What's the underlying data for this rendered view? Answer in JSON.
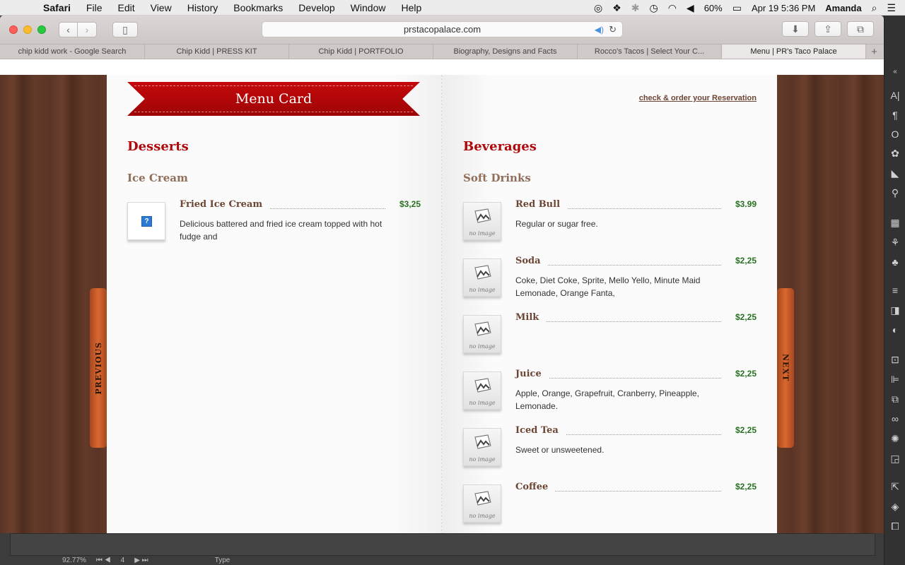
{
  "menubar": {
    "app": "Safari",
    "items": [
      "File",
      "Edit",
      "View",
      "History",
      "Bookmarks",
      "Develop",
      "Window",
      "Help"
    ],
    "battery": "60%",
    "datetime": "Apr 19  5:36 PM",
    "user": "Amanda"
  },
  "browser": {
    "url": "prstacopalace.com",
    "tabs": [
      {
        "label": "chip kidd work - Google Search",
        "active": false
      },
      {
        "label": "Chip Kidd | PRESS KIT",
        "active": false
      },
      {
        "label": "Chip Kidd | PORTFOLIO",
        "active": false
      },
      {
        "label": "Biography, Designs and Facts",
        "active": false
      },
      {
        "label": "Rocco's Tacos | Select Your C...",
        "active": false
      },
      {
        "label": "Menu | PR's Taco Palace",
        "active": true
      }
    ]
  },
  "menu": {
    "ribbon_title": "Menu Card",
    "reservation_link": "check & order your Reservation",
    "prev_label": "PREVIOUS",
    "next_label": "NEXT",
    "no_image_caption": "no image",
    "left": {
      "section": "Desserts",
      "category": "Ice Cream",
      "items": [
        {
          "name": "Fried Ice Cream",
          "price": "$3,25",
          "desc": "Delicious battered and fried ice cream topped with hot fudge and"
        }
      ]
    },
    "right": {
      "section": "Beverages",
      "category": "Soft Drinks",
      "items": [
        {
          "name": "Red Bull",
          "price": "$3.99",
          "desc": "Regular or sugar free."
        },
        {
          "name": "Soda",
          "price": "$2,25",
          "desc": "Coke, Diet Coke, Sprite, Mello Yello, Minute Maid Lemonade, Orange Fanta,"
        },
        {
          "name": "Milk",
          "price": "$2,25",
          "desc": ""
        },
        {
          "name": "Juice",
          "price": "$2,25",
          "desc": "Apple, Orange, Grapefruit, Cranberry, Pineapple, Lemonade."
        },
        {
          "name": "Iced Tea",
          "price": "$2,25",
          "desc": "Sweet or unsweetened."
        },
        {
          "name": "Coffee",
          "price": "$2,25",
          "desc": ""
        }
      ]
    }
  },
  "status": {
    "zoom": "92.77%",
    "page": "4",
    "mode": "Type"
  }
}
